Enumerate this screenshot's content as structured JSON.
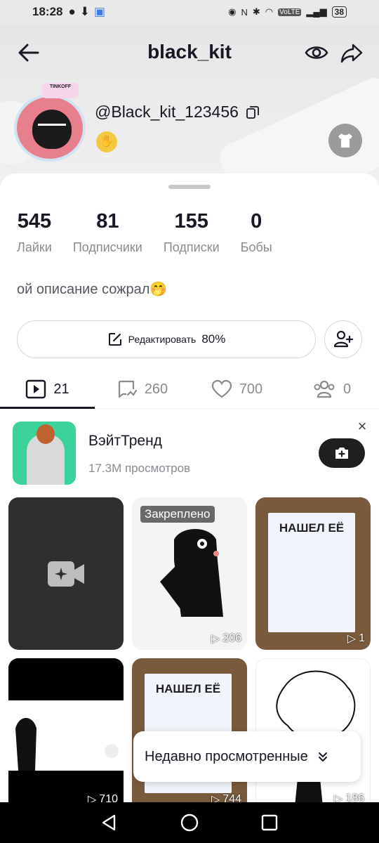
{
  "status_bar": {
    "time": "18:28",
    "network": "VoLTE",
    "battery": "38"
  },
  "header": {
    "title": "black_kit",
    "username": "@Black_kit_123456",
    "badge_text": "TINKOFF"
  },
  "stats": [
    {
      "value": "545",
      "label": "Лайки"
    },
    {
      "value": "81",
      "label": "Подписчики"
    },
    {
      "value": "155",
      "label": "Подписки"
    },
    {
      "value": "0",
      "label": "Бобы"
    }
  ],
  "bio": "ой описание сожрал🤭",
  "edit_button": {
    "label": "Редактировать",
    "percent": "80%"
  },
  "tabs": [
    {
      "icon": "video-icon",
      "count": "21"
    },
    {
      "icon": "repost-icon",
      "count": "260"
    },
    {
      "icon": "heart-icon",
      "count": "700"
    },
    {
      "icon": "friends-icon",
      "count": "0"
    }
  ],
  "trend": {
    "title": "ВэйтТренд",
    "views": "17.3M просмотров"
  },
  "grid": {
    "pinned_label": "Закреплено",
    "tiles": [
      {
        "views": ""
      },
      {
        "views": "206"
      },
      {
        "views": "1",
        "text": "НАШЕЛ ЕЁ"
      },
      {
        "views": "710"
      },
      {
        "views": "744",
        "text": "НАШЕЛ ЕЁ"
      },
      {
        "views": "186"
      }
    ]
  },
  "recent": {
    "label": "Недавно просмотренные"
  }
}
